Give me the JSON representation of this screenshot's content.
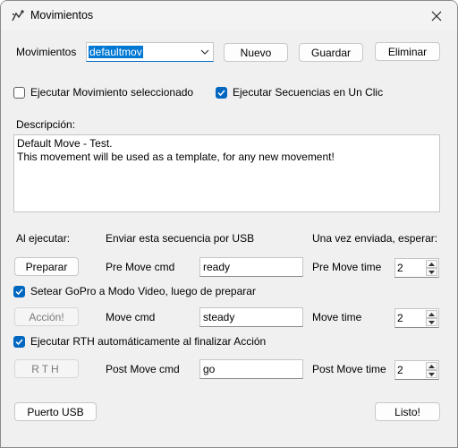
{
  "window": {
    "title": "Movimientos"
  },
  "movimientos": {
    "label": "Movimientos",
    "selected": "defaultmov",
    "nuevo": "Nuevo",
    "guardar": "Guardar",
    "eliminar": "Eliminar"
  },
  "options": {
    "ejecutar_mov": {
      "label": "Ejecutar Movimiento seleccionado",
      "checked": false
    },
    "ejecutar_seq": {
      "label": "Ejecutar Secuencias en Un Clic",
      "checked": true
    }
  },
  "descripcion": {
    "label": "Descripción:",
    "text": "Default Move - Test.\nThis movement will be used as a template, for any new movement!"
  },
  "headers": {
    "al_ejecutar": "Al ejecutar:",
    "enviar": "Enviar esta secuencia por USB",
    "esperar": "Una vez enviada, esperar:"
  },
  "pre": {
    "button": "Preparar",
    "cmd_label": "Pre Move cmd",
    "cmd_value": "ready",
    "time_label": "Pre Move time",
    "time_value": "2"
  },
  "gopro_check": {
    "label": "Setear GoPro a Modo Video, luego de preparar",
    "checked": true
  },
  "move": {
    "button": "Acción!",
    "cmd_label": "Move cmd",
    "cmd_value": "steady",
    "time_label": "Move time",
    "time_value": "2"
  },
  "rth_check": {
    "label": "Ejecutar RTH automáticamente al finalizar Acción",
    "checked": true
  },
  "post": {
    "button": "RTH",
    "cmd_label": "Post Move cmd",
    "cmd_value": "go",
    "time_label": "Post Move time",
    "time_value": "2"
  },
  "footer": {
    "puerto": "Puerto USB",
    "listo": "Listo!"
  },
  "colors": {
    "accent": "#0067c0",
    "selection": "#0078d4",
    "background": "#f0f0f0"
  }
}
